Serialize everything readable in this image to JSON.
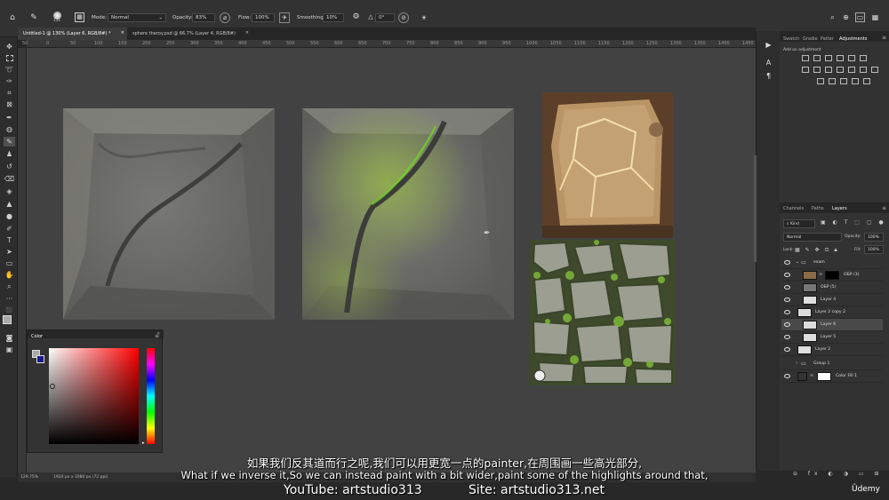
{
  "options_bar": {
    "brush_size": "151",
    "mode_label": "Mode:",
    "mode_value": "Normal",
    "opacity_label": "Opacity:",
    "opacity_value": "83%",
    "flow_label": "Flow:",
    "flow_value": "100%",
    "smoothing_label": "Smoothing:",
    "smoothing_value": "10%",
    "angle_value": "0°"
  },
  "tabs": [
    {
      "label": "Untitled-1 @ 130% (Layer 6, RGB/8#) *"
    },
    {
      "label": "sphere theroy.psd @ 66.7% (Layer 4, RGB/8#)"
    }
  ],
  "ruler_labels": [
    "50",
    "0",
    "50",
    "100",
    "150",
    "200",
    "250",
    "300",
    "350",
    "400",
    "450",
    "500",
    "550",
    "600",
    "650",
    "700",
    "750",
    "800",
    "850",
    "900",
    "950",
    "1000",
    "1050",
    "1100",
    "1150",
    "1200",
    "1250",
    "1300",
    "1350",
    "1400",
    "1450",
    "1500",
    "1550"
  ],
  "color_panel": {
    "title": "Color"
  },
  "right_panel": {
    "top_tabs": [
      "Swatch",
      "Gradie",
      "Patter",
      "Adjustments"
    ],
    "add_adjustment": "Add an adjustment",
    "layer_tabs": [
      "Channels",
      "Paths",
      "Layers"
    ],
    "kind": "Kind",
    "blend": "Normal",
    "opacity_label": "Opacity:",
    "opacity_value": "100%",
    "lock_label": "Lock:",
    "fill_label": "Fill:",
    "fill_value": "100%",
    "layers": [
      {
        "name": "exam"
      },
      {
        "name": "ОБР (3)"
      },
      {
        "name": "ОБР (5)"
      },
      {
        "name": "Layer 4"
      },
      {
        "name": "Layer 2 copy 2"
      },
      {
        "name": "Layer 6"
      },
      {
        "name": "Layer 5"
      },
      {
        "name": "Layer 2"
      },
      {
        "name": "Group 1"
      },
      {
        "name": "Color Fill 1"
      }
    ]
  },
  "status": {
    "zoom": "129.75%",
    "doc": "1920 px x 1080 px (72 ppi)"
  },
  "subtitles": {
    "chinese": "如果我们反其道而行之呢,我们可以用更宽一点的painter,在周围画一些高光部分,",
    "english": "What if we inverse it,So we can instead paint with a bit wider,paint some of the highlights around that,",
    "youtube": "YouTube: artstudio313",
    "site": "Site: artstudio313.net"
  },
  "watermark": "Ûdemy",
  "colors": {
    "accent": "#1473e6",
    "canvas": "#424242"
  }
}
